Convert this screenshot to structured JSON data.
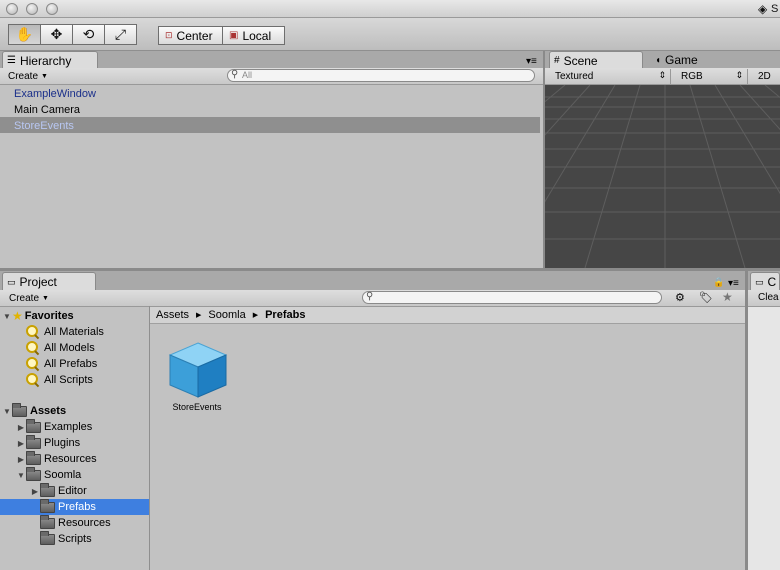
{
  "toolbar": {
    "tools": [
      "hand-tool",
      "move-tool",
      "rotate-tool",
      "scale-tool"
    ],
    "pivot_mode": "Center",
    "pivot_rotation": "Local"
  },
  "title_tail": "S",
  "hierarchy": {
    "tab_label": "Hierarchy",
    "create_label": "Create",
    "search_placeholder": "All",
    "items": [
      "ExampleWindow",
      "Main Camera",
      "StoreEvents"
    ]
  },
  "scene": {
    "tab_scene": "Scene",
    "tab_game": "Game",
    "render_mode": "Textured",
    "color_mode": "RGB",
    "mode_2d": "2D"
  },
  "project": {
    "tab_label": "Project",
    "create_label": "Create",
    "favorites_label": "Favorites",
    "favorites": [
      "All Materials",
      "All Models",
      "All Prefabs",
      "All Scripts"
    ],
    "assets_label": "Assets",
    "folders": [
      "Examples",
      "Plugins",
      "Resources",
      "Soomla"
    ],
    "soomla_children": [
      "Editor",
      "Prefabs",
      "Resources",
      "Scripts"
    ],
    "breadcrumb": [
      "Assets",
      "Soomla",
      "Prefabs"
    ],
    "asset_name": "StoreEvents"
  },
  "right_panel": {
    "tab_label": "C",
    "button_label": "Clea"
  },
  "colors": {
    "selection_blue": "#3e7fe0",
    "hierarchy_selection": "#8f8f8f",
    "prefab_text": "#1a2f8a"
  }
}
